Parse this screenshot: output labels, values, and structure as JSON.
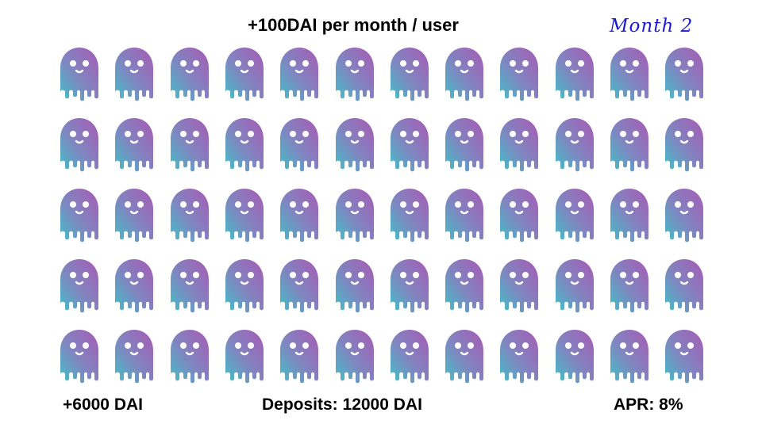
{
  "header": {
    "title": "+100DAI per month / user",
    "month": "Month 2"
  },
  "grid": {
    "rows": 5,
    "cols": 12,
    "icon": "ghost-icon",
    "gradient_colors": [
      "#43c0c8",
      "#a85ab4"
    ]
  },
  "footer": {
    "earned": "+6000 DAI",
    "deposits": "Deposits: 12000 DAI",
    "apr": "APR: 8%"
  }
}
